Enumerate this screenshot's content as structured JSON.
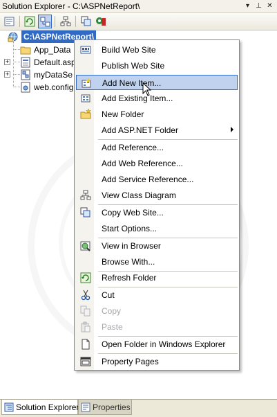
{
  "window": {
    "title": "Solution Explorer - C:\\ASPNetReport\\",
    "dropdown_glyph": "▾",
    "pin_glyph": "⊥",
    "close_glyph": "✕"
  },
  "toolbar": {
    "buttons": [
      "properties-icon",
      "refresh-icon",
      "nest-related-files-icon",
      "view-class-diagram-icon",
      "copy-web-site-icon",
      "asp-net-configuration-icon"
    ]
  },
  "tree": {
    "root": {
      "label": "C:\\ASPNetReport\\",
      "expander": "−"
    },
    "items": [
      {
        "label": "App_Data",
        "icon": "folder-icon",
        "expander": ""
      },
      {
        "label": "Default.asp",
        "icon": "aspx-page-icon",
        "expander": "+"
      },
      {
        "label": "myDataSe",
        "icon": "dataset-icon",
        "expander": "+"
      },
      {
        "label": "web.config",
        "icon": "config-file-icon",
        "expander": ""
      }
    ]
  },
  "context_menu": {
    "items": [
      {
        "label": "Build Web Site",
        "icon": "build-icon",
        "disabled": false,
        "submenu": false
      },
      {
        "label": "Publish Web Site",
        "icon": "",
        "disabled": false,
        "submenu": false
      },
      {
        "label": "Add New Item...",
        "icon": "add-new-item-icon",
        "disabled": false,
        "submenu": false,
        "hover": true
      },
      {
        "label": "Add Existing Item...",
        "icon": "add-existing-item-icon",
        "disabled": false,
        "submenu": false
      },
      {
        "label": "New Folder",
        "icon": "new-folder-icon",
        "disabled": false,
        "submenu": false
      },
      {
        "label": "Add ASP.NET Folder",
        "icon": "",
        "disabled": false,
        "submenu": true
      },
      {
        "label": "Add Reference...",
        "icon": "",
        "disabled": false,
        "submenu": false
      },
      {
        "label": "Add Web Reference...",
        "icon": "",
        "disabled": false,
        "submenu": false
      },
      {
        "label": "Add Service Reference...",
        "icon": "",
        "disabled": false,
        "submenu": false
      },
      {
        "label": "View Class Diagram",
        "icon": "class-diagram-icon",
        "disabled": false,
        "submenu": false
      },
      {
        "label": "Copy Web Site...",
        "icon": "copy-web-site-icon",
        "disabled": false,
        "submenu": false
      },
      {
        "label": "Start Options...",
        "icon": "",
        "disabled": false,
        "submenu": false
      },
      {
        "label": "View in Browser",
        "icon": "view-in-browser-icon",
        "disabled": false,
        "submenu": false
      },
      {
        "label": "Browse With...",
        "icon": "",
        "disabled": false,
        "submenu": false
      },
      {
        "label": "Refresh Folder",
        "icon": "refresh-icon",
        "disabled": false,
        "submenu": false
      },
      {
        "label": "Cut",
        "icon": "cut-icon",
        "disabled": false,
        "submenu": false
      },
      {
        "label": "Copy",
        "icon": "copy-icon",
        "disabled": true,
        "submenu": false
      },
      {
        "label": "Paste",
        "icon": "paste-icon",
        "disabled": true,
        "submenu": false
      },
      {
        "label": "Open Folder in Windows Explorer",
        "icon": "open-folder-icon",
        "disabled": false,
        "submenu": false
      },
      {
        "label": "Property Pages",
        "icon": "property-pages-icon",
        "disabled": false,
        "submenu": false
      }
    ]
  },
  "bottom_tabs": [
    {
      "label": "Solution Explorer",
      "active": true
    },
    {
      "label": "Properties",
      "active": false
    }
  ],
  "colors": {
    "selection": "#316ac5",
    "hover_bg": "#c1d2ee",
    "chrome": "#ece9d8"
  }
}
